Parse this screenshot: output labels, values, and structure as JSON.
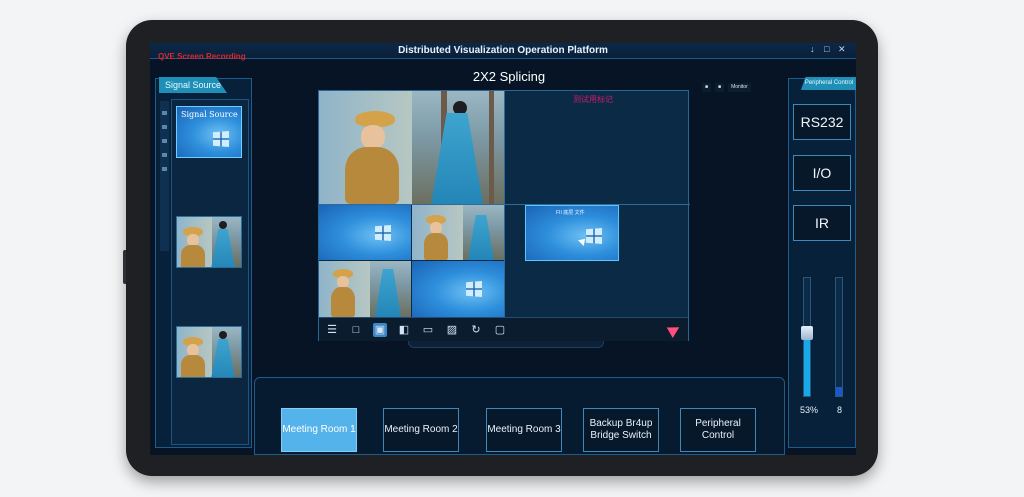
{
  "app_title": "Distributed Visualization Operation Platform",
  "recording_label": "QVE Screen Recording",
  "window_controls": [
    "↓",
    "□",
    "✕"
  ],
  "signal_source": {
    "tab_label": "Signal Source",
    "thumbnails": [
      {
        "type": "desktop",
        "label": "Signal Source"
      },
      {
        "type": "photo",
        "label": ""
      },
      {
        "type": "photo",
        "label": ""
      }
    ]
  },
  "center": {
    "title": "2X2 Splicing",
    "quad_label": "测试用标记",
    "desktop_window_text": "FII 底层 文件",
    "mini_buttons": [
      "■",
      "■",
      "Monitor"
    ]
  },
  "toolbar": {
    "icons": [
      "list-icon",
      "single-window-icon",
      "quad-split-icon",
      "overlay-window-icon",
      "frame-icon",
      "pip-icon",
      "rotate-icon",
      "window-icon",
      "send-icon"
    ],
    "glyphs": [
      "☰",
      "□",
      "▣",
      "◧",
      "▭",
      "▨",
      "↻",
      "▢"
    ]
  },
  "rooms": [
    {
      "label": "Meeting Room 1",
      "active": true
    },
    {
      "label": "Meeting Room 2",
      "active": false
    },
    {
      "label": "Meeting Room 3",
      "active": false
    },
    {
      "label": "Backup Br4up Bridge Switch",
      "active": false
    },
    {
      "label": "Peripheral Control",
      "active": false
    }
  ],
  "peripheral": {
    "tab_label": "Peripheral Control",
    "buttons": [
      "RS232",
      "I/O",
      "IR"
    ],
    "slider_left": {
      "value_label": "53%",
      "level": 0.53,
      "color": "#19a9e8"
    },
    "slider_right": {
      "value_label": "8",
      "level": 0.08,
      "color": "#1f56c8"
    }
  },
  "colors": {
    "accent": "#1f8fb8",
    "active_button": "#55b3ec",
    "background": "#061425",
    "record_red": "#e0262a"
  }
}
